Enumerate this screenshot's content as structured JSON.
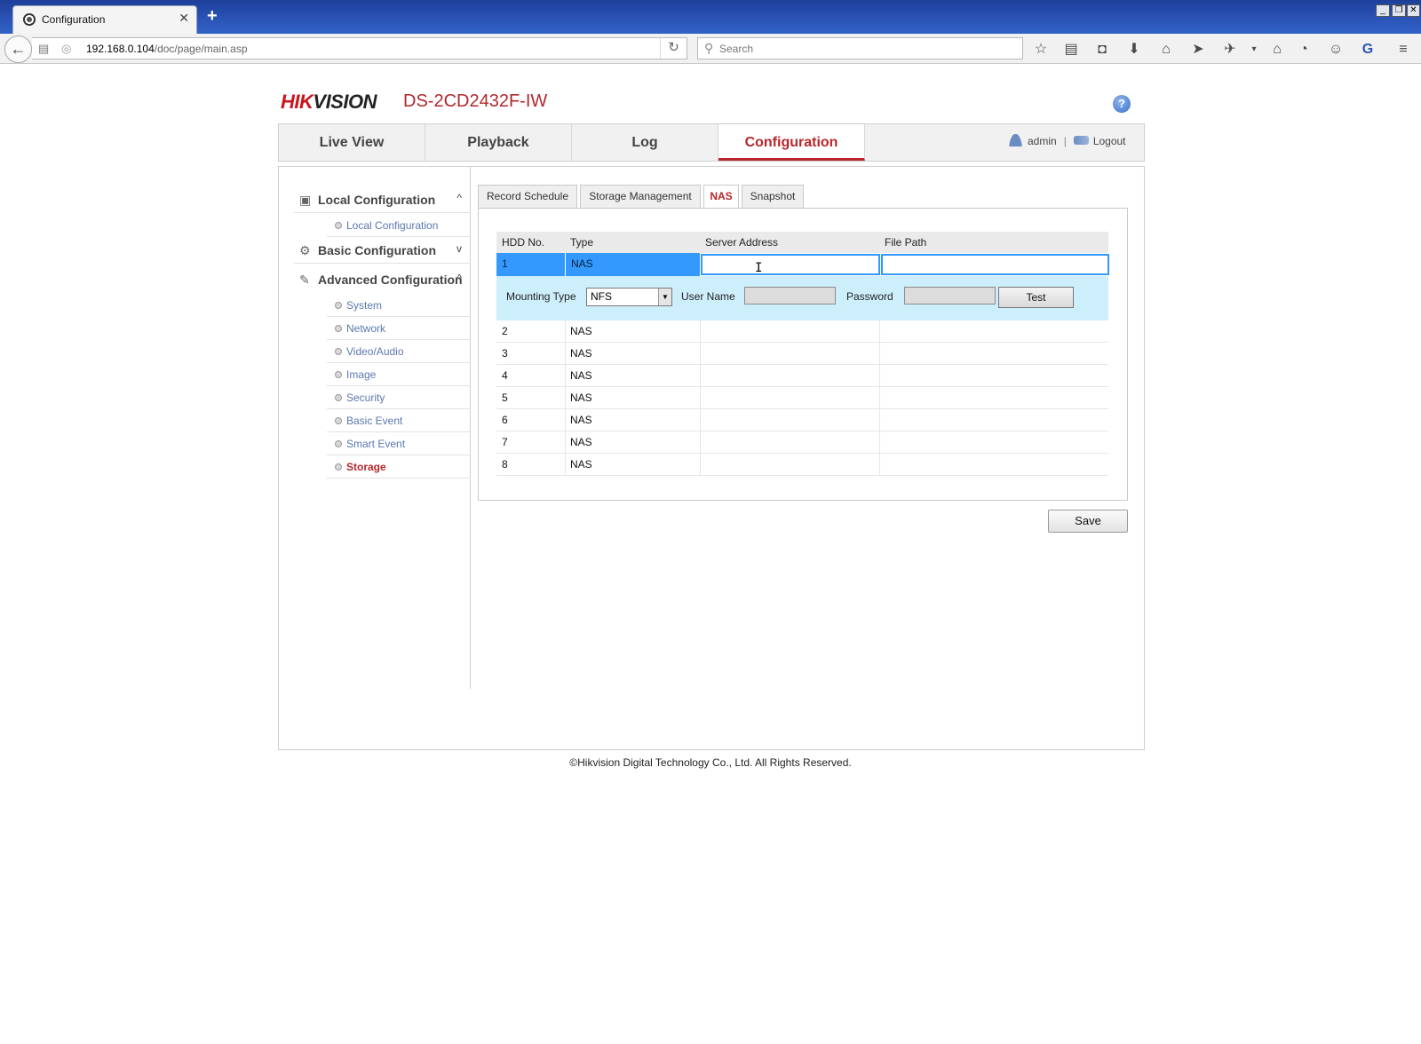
{
  "browser": {
    "tab_title": "Configuration",
    "url_host": "192.168.0.104",
    "url_path": "/doc/page/main.asp",
    "search_placeholder": "Search",
    "toolbar_icons": [
      "star-icon",
      "reader-icon",
      "pocket-icon",
      "download-icon",
      "home-icon",
      "send-icon",
      "extension-icon",
      "dropdown-icon",
      "sync-icon",
      "history-icon",
      "chat-icon",
      "g-extension-icon",
      "menu-icon"
    ]
  },
  "header": {
    "logo_left": "HIK",
    "logo_right": "VISION",
    "model": "DS-2CD2432F-IW",
    "help": "?"
  },
  "mainnav": {
    "tabs": [
      "Live View",
      "Playback",
      "Log",
      "Configuration"
    ],
    "active": "Configuration",
    "user": "admin",
    "separator": "|",
    "logout": "Logout"
  },
  "sidebar": {
    "groups": [
      {
        "label": "Local Configuration",
        "caret": "^",
        "icon": "monitor-icon"
      },
      {
        "label": "Basic Configuration",
        "caret": "v",
        "icon": "gear-icon"
      },
      {
        "label": "Advanced Configuration",
        "caret": "^",
        "icon": "wrench-icon"
      }
    ],
    "local_items": [
      "Local Configuration"
    ],
    "advanced_items": [
      "System",
      "Network",
      "Video/Audio",
      "Image",
      "Security",
      "Basic Event",
      "Smart Event",
      "Storage"
    ],
    "active_item": "Storage"
  },
  "subtabs": [
    "Record Schedule",
    "Storage Management",
    "NAS",
    "Snapshot"
  ],
  "active_subtab": "NAS",
  "grid": {
    "headers": [
      "HDD No.",
      "Type",
      "Server Address",
      "File Path"
    ],
    "selected_row": {
      "hdd": "1",
      "type": "NAS",
      "server_address": "",
      "file_path": ""
    },
    "mounting": {
      "label": "Mounting Type",
      "value": "NFS",
      "user_label": "User Name",
      "password_label": "Password",
      "test_button": "Test"
    },
    "rows": [
      {
        "hdd": "2",
        "type": "NAS"
      },
      {
        "hdd": "3",
        "type": "NAS"
      },
      {
        "hdd": "4",
        "type": "NAS"
      },
      {
        "hdd": "5",
        "type": "NAS"
      },
      {
        "hdd": "6",
        "type": "NAS"
      },
      {
        "hdd": "7",
        "type": "NAS"
      },
      {
        "hdd": "8",
        "type": "NAS"
      }
    ]
  },
  "save_button": "Save",
  "footer": "©Hikvision Digital Technology Co., Ltd. All Rights Reserved.",
  "colors": {
    "brand": "#c8161d",
    "accent_blue": "#3399ff",
    "mount_bg": "#cdeefb",
    "link": "#5b77b0"
  }
}
